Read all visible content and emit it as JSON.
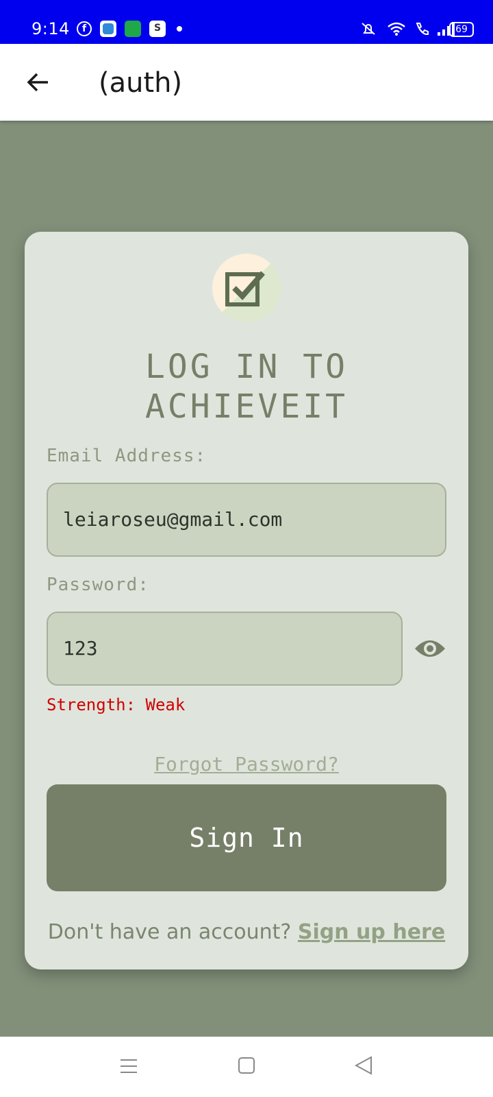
{
  "status_bar": {
    "time": "9:14",
    "notification_icons": [
      "facebook-icon",
      "blue-app-icon",
      "calculator-icon",
      "shop-icon",
      "dot-icon"
    ],
    "system_icons": [
      "mute-icon",
      "wifi-icon",
      "call-icon",
      "signal-icon"
    ],
    "battery": "69"
  },
  "app_bar": {
    "title": "(auth)",
    "back_icon": "arrow-back-icon"
  },
  "card": {
    "logo_icon": "checkbox-icon",
    "heading": "LOG IN TO ACHIEVEIT",
    "email": {
      "label": "Email Address:",
      "value": "leiaroseu@gmail.com"
    },
    "password": {
      "label": "Password:",
      "value": "123",
      "toggle_icon": "eye-icon"
    },
    "strength": "Strength: Weak",
    "forgot": "Forgot Password?",
    "signin_button": "Sign In",
    "signup_prompt": "Don't have an account?",
    "signup_link": "Sign up here"
  },
  "colors": {
    "background": "#82907a",
    "card": "#dfe5dc",
    "accent": "#768068",
    "input": "#cbd4c1",
    "error": "#d00000",
    "status_bar": "#0000ee"
  },
  "nav_bar": {
    "icons": [
      "menu-icon",
      "home-icon",
      "back-icon"
    ]
  }
}
